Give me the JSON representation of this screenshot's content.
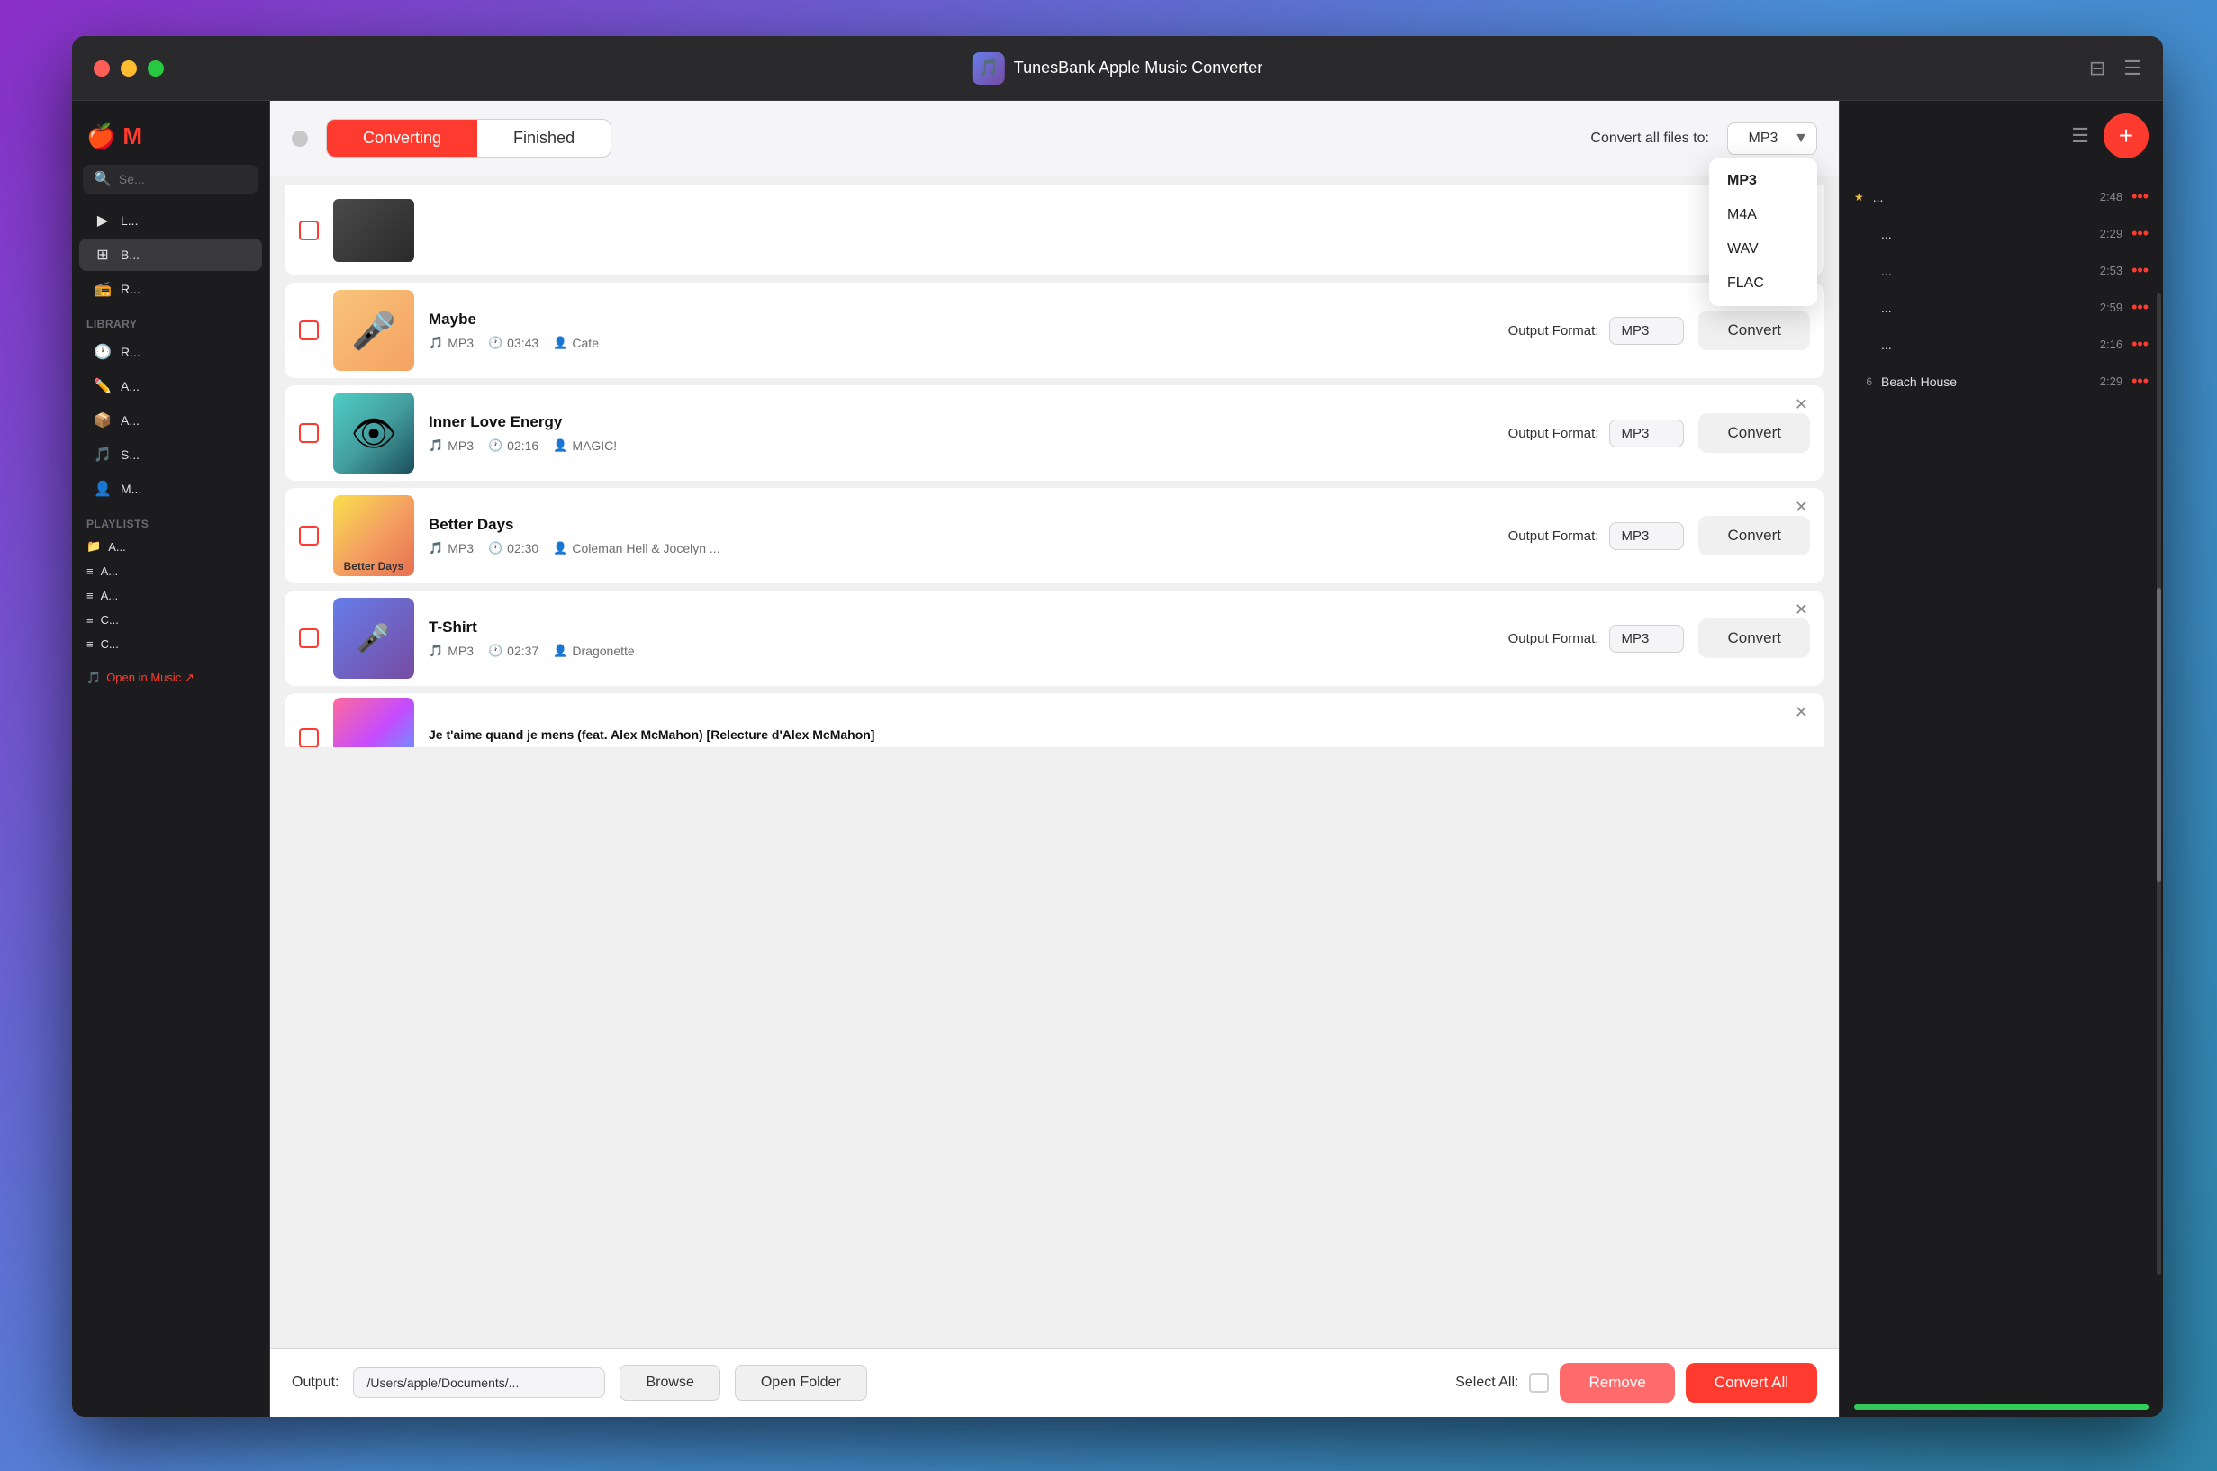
{
  "app": {
    "title": "TunesBank Apple Music Converter",
    "icon": "🎵"
  },
  "titlebar": {
    "title": "TunesBank Apple Music Converter",
    "playlist_icon": "⊟",
    "menu_icon": "☰"
  },
  "tabs": {
    "converting": "Converting",
    "finished": "Finished"
  },
  "header": {
    "convert_all_label": "Convert all files to:",
    "format_selected": "MP3"
  },
  "format_options": [
    "MP3",
    "M4A",
    "WAV",
    "FLAC"
  ],
  "songs": [
    {
      "id": "maybe",
      "title": "Maybe",
      "format": "MP3",
      "duration": "03:43",
      "artist": "Cate",
      "output_format": "MP3",
      "artwork_class": "artwork-maybe",
      "artwork_emoji": ""
    },
    {
      "id": "inner-love-energy",
      "title": "Inner Love Energy",
      "format": "MP3",
      "duration": "02:16",
      "artist": "MAGIC!",
      "output_format": "MP3",
      "artwork_class": "artwork-inner",
      "artwork_emoji": "👁"
    },
    {
      "id": "better-days",
      "title": "Better Days",
      "format": "MP3",
      "duration": "02:30",
      "artist": "Coleman Hell & Jocelyn ...",
      "output_format": "MP3",
      "artwork_class": "artwork-better",
      "artwork_emoji": ""
    },
    {
      "id": "t-shirt",
      "title": "T-Shirt",
      "format": "MP3",
      "duration": "02:37",
      "artist": "Dragonette",
      "output_format": "MP3",
      "artwork_class": "artwork-tshirt",
      "artwork_emoji": ""
    }
  ],
  "bottom_truncated_title": "Je t'aime quand je mens (feat. Alex McMahon) [Relecture d'Alex McMahon]",
  "bottom_bar": {
    "output_label": "Output:",
    "output_path": "/Users/apple/Documents/...",
    "browse": "Browse",
    "open_folder": "Open Folder",
    "select_all": "Select All:",
    "remove": "Remove",
    "convert_all": "Convert All"
  },
  "sidebar": {
    "logo": "♪",
    "m_letter": "M",
    "search_placeholder": "Se...",
    "nav_items": [
      {
        "icon": "▶",
        "label": "L...",
        "active": false
      },
      {
        "icon": "⊞",
        "label": "B...",
        "active": true
      },
      {
        "icon": "📻",
        "label": "R...",
        "active": false
      }
    ],
    "library_label": "Library",
    "library_items": [
      {
        "icon": "🕐",
        "label": "R...",
        "color": "#ff9500"
      },
      {
        "icon": "✏️",
        "label": "A...",
        "color": "#ff2d55"
      },
      {
        "icon": "📦",
        "label": "A...",
        "color": "#ff9500"
      },
      {
        "icon": "🎵",
        "label": "S...",
        "color": "#007aff"
      },
      {
        "icon": "👤",
        "label": "M...",
        "color": "#34aadc"
      }
    ],
    "playlists_label": "Playlists",
    "playlist_items": [
      {
        "icon": "📁",
        "label": "A..."
      },
      {
        "icon": "≡↓",
        "label": "A..."
      },
      {
        "icon": "≡↓",
        "label": "A..."
      },
      {
        "icon": "≡↓",
        "label": "C..."
      },
      {
        "icon": "≡↓",
        "label": "C..."
      }
    ],
    "open_in_music": "Open in Music ↗"
  },
  "right_panel": {
    "items": [
      {
        "num": "",
        "star": true,
        "title": "...",
        "duration": "2:48",
        "has_dots": true
      },
      {
        "num": "",
        "star": false,
        "title": "...",
        "duration": "2:29",
        "has_dots": true
      },
      {
        "num": "",
        "star": false,
        "title": "...",
        "duration": "2:53",
        "has_dots": true
      },
      {
        "num": "",
        "star": false,
        "title": "...",
        "duration": "2:59",
        "has_dots": true
      },
      {
        "num": "",
        "star": false,
        "title": "...",
        "duration": "2:16",
        "has_dots": true
      },
      {
        "num": "6",
        "star": false,
        "title": "Beach House",
        "duration": "2:29",
        "has_dots": true
      }
    ]
  },
  "buttons": {
    "convert": "Convert",
    "convert_all": "Convert All"
  }
}
